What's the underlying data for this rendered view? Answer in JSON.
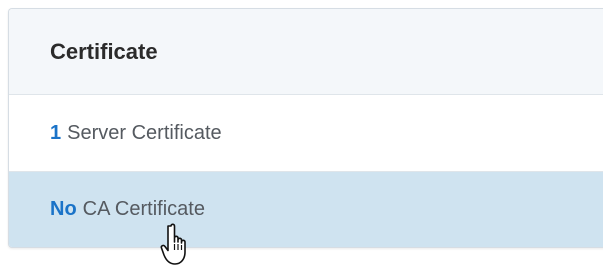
{
  "panel": {
    "title": "Certificate",
    "rows": [
      {
        "count": "1",
        "label": "Server Certificate"
      },
      {
        "count": "No",
        "label": "CA Certificate"
      }
    ]
  },
  "colors": {
    "count_accent": "#1a73c8",
    "selected_row": "#cfe3f0",
    "header_bg": "#f4f7fa"
  },
  "cursor": {
    "icon": "hand-pointer-icon"
  }
}
